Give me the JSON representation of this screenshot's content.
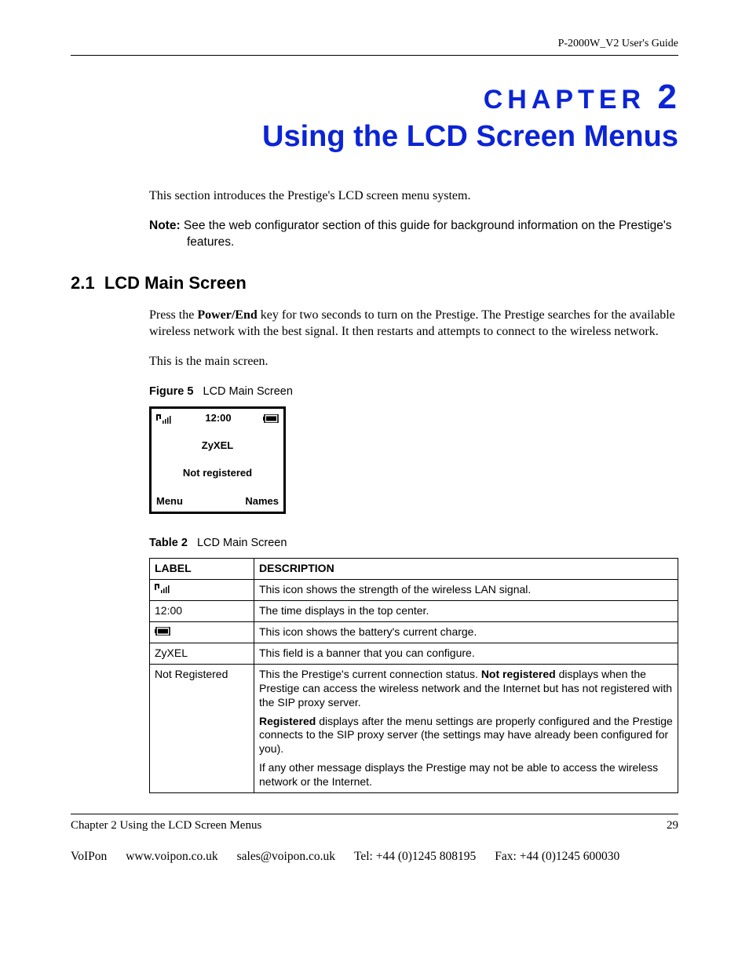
{
  "header": {
    "doc_title": "P-2000W_V2 User's Guide"
  },
  "chapter": {
    "label_prefix": "CHAPTER",
    "label_number": "2",
    "title": "Using the LCD Screen Menus"
  },
  "intro": "This section introduces the Prestige's LCD screen menu system.",
  "note": {
    "prefix": "Note:",
    "text": "See the web configurator section of this guide for background information on the Prestige's features."
  },
  "section": {
    "number": "2.1",
    "title": "LCD Main Screen"
  },
  "para1_a": "Press the ",
  "para1_key": "Power/End",
  "para1_b": " key for two seconds to turn on the Prestige. The Prestige searches for the available wireless network with the best signal. It then restarts and attempts to connect to the wireless network.",
  "para2": "This is the main screen.",
  "figure": {
    "label": "Figure 5",
    "title": "LCD Main Screen"
  },
  "lcd": {
    "time": "12:00",
    "banner": "ZyXEL",
    "status": "Not registered",
    "left_soft": "Menu",
    "right_soft": "Names"
  },
  "table": {
    "label": "Table 2",
    "title": "LCD Main Screen",
    "head": {
      "c1": "LABEL",
      "c2": "DESCRIPTION"
    },
    "rows": [
      {
        "label_icon": "signal",
        "desc_plain": "This icon shows the strength of the wireless LAN signal."
      },
      {
        "label": "12:00",
        "desc_plain": "The time displays in the top center."
      },
      {
        "label_icon": "battery",
        "desc_plain": "This icon shows the battery's current charge."
      },
      {
        "label": "ZyXEL",
        "desc_plain": "This field is a banner that you can configure."
      },
      {
        "label": "Not Registered",
        "desc_paras": [
          {
            "a": "This the Prestige's current connection status. ",
            "bold": "Not registered",
            "b": " displays when the Prestige can access the wireless network and the Internet but has not registered with the SIP proxy server."
          },
          {
            "bold": "Registered",
            "b": " displays after the menu settings are properly configured and the Prestige connects to the SIP proxy server (the settings may have already been configured for you)."
          },
          {
            "a": "If any other message displays the Prestige may not be able to access the wireless network or the Internet."
          }
        ]
      }
    ]
  },
  "footer": {
    "left": "Chapter 2 Using the LCD Screen Menus",
    "page": "29",
    "company": "VoIPon",
    "url": "www.voipon.co.uk",
    "email": "sales@voipon.co.uk",
    "tel": "Tel: +44 (0)1245 808195",
    "fax": "Fax: +44 (0)1245 600030"
  }
}
